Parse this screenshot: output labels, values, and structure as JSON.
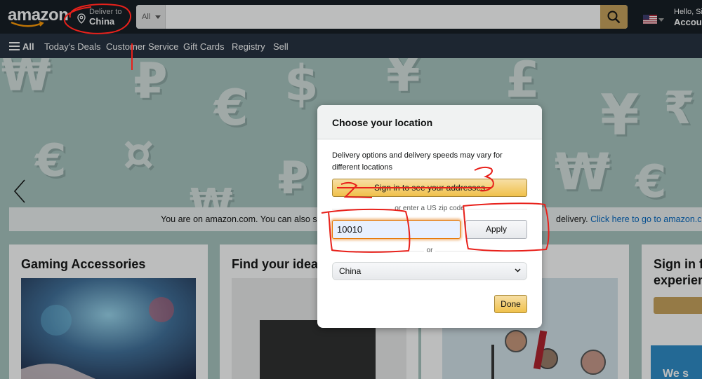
{
  "header": {
    "logo": "amazon",
    "deliver_to_label": "Deliver to",
    "deliver_to_location": "China",
    "search_category": "All",
    "search_value": "",
    "account_greeting": "Hello, Si",
    "account_label": "Accoun"
  },
  "subnav": {
    "all_label": "All",
    "items": [
      "Today's Deals",
      "Customer Service",
      "Gift Cards",
      "Registry",
      "Sell"
    ]
  },
  "notice": {
    "text": "You are on amazon.com. You can also sho",
    "text_end": "delivery. ",
    "link": "Click here to go to amazon.cn"
  },
  "cards": [
    {
      "title": "Gaming Accessories"
    },
    {
      "title": "Find your idea"
    },
    {
      "title": "Sign in f"
    },
    {
      "title": "experien"
    },
    {
      "title": "We s"
    }
  ],
  "modal": {
    "title": "Choose your location",
    "description": "Delivery options and delivery speeds may vary for different locations",
    "signin_button": "Sign in to see your addresses",
    "zip_divider": "or enter a US zip code",
    "zip_value": "10010",
    "apply_button": "Apply",
    "or_divider": "or",
    "country_selected": "China",
    "done_button": "Done"
  },
  "annotations": {
    "color": "#e8211b",
    "marks": [
      "1",
      "2",
      "3"
    ]
  },
  "colors": {
    "nav_top": "#131921",
    "nav_sub": "#232f3e",
    "search_button": "#c9a25a",
    "primary_button": "#f0c14b",
    "link": "#0066c0"
  }
}
